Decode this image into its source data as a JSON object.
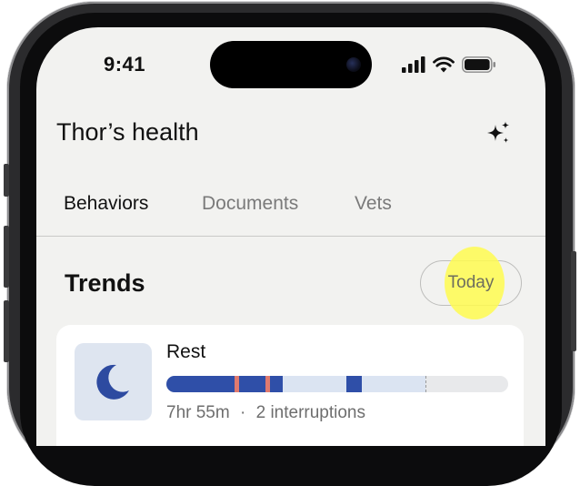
{
  "status_bar": {
    "time": "9:41"
  },
  "header": {
    "title": "Thor’s health",
    "action_icon": "sparkles-icon"
  },
  "tabs": [
    {
      "label": "Behaviors",
      "active": true
    },
    {
      "label": "Documents",
      "active": false
    },
    {
      "label": "Vets",
      "active": false
    }
  ],
  "trends": {
    "title": "Trends",
    "range_label": "Today"
  },
  "rest_card": {
    "icon": "moon-icon",
    "title": "Rest",
    "duration": "7hr 55m",
    "separator": "·",
    "interruptions": "2 interruptions"
  },
  "colors": {
    "deep_rest": "#2f4fa8",
    "light_rest": "#dbe4f2",
    "interruption": "#e07a6f",
    "moon": "#2d4aa0",
    "highlight": "#fff94f"
  }
}
